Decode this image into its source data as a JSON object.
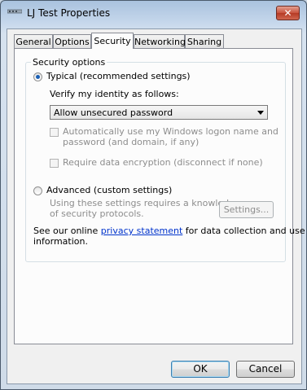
{
  "window": {
    "title": "LJ Test Properties",
    "close_glyph": "✕",
    "icon": "network-connection-icon"
  },
  "tabs": [
    {
      "label": "General",
      "active": false
    },
    {
      "label": "Options",
      "active": false
    },
    {
      "label": "Security",
      "active": true
    },
    {
      "label": "Networking",
      "active": false
    },
    {
      "label": "Sharing",
      "active": false
    }
  ],
  "security": {
    "group_label": "Security options",
    "typical_label": "Typical (recommended settings)",
    "typical_selected": true,
    "verify_label": "Verify my identity as follows:",
    "verify_value": "Allow unsecured password",
    "auto_logon_line1": "Automatically use my Windows logon name and",
    "auto_logon_line2": "password (and domain, if any)",
    "auto_logon_checked": false,
    "require_encryption_label": "Require data encryption (disconnect if none)",
    "require_encryption_checked": false,
    "advanced_label": "Advanced (custom settings)",
    "advanced_selected": false,
    "advanced_desc_line1": "Using these settings requires a knowledge",
    "advanced_desc_line2": "of security protocols.",
    "settings_button": "Settings...",
    "privacy_prefix": "See our online ",
    "privacy_link": "privacy statement",
    "privacy_suffix": " for data collection and use",
    "privacy_line2": "information."
  },
  "footer": {
    "ok_label": "OK",
    "cancel_label": "Cancel"
  },
  "colors": {
    "accent": "#1a5fb4",
    "link": "#0033cc",
    "close_button": "#c8513d"
  }
}
